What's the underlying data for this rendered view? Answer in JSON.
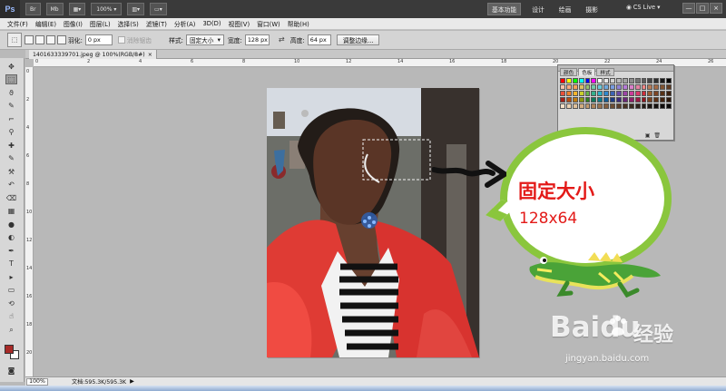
{
  "app": {
    "logo": "Ps",
    "zoom": "100%",
    "workspace_tabs": [
      "基本功能",
      "设计",
      "绘画",
      "摄影"
    ],
    "cslive": "CS Live",
    "window_controls": [
      "—",
      "□",
      "×"
    ]
  },
  "menu": [
    "文件(F)",
    "编辑(E)",
    "图像(I)",
    "图层(L)",
    "选择(S)",
    "滤镜(T)",
    "分析(A)",
    "3D(D)",
    "视图(V)",
    "窗口(W)",
    "帮助(H)"
  ],
  "options": {
    "feather_label": "羽化:",
    "feather_value": "0 px",
    "antialias_label": "消除锯齿",
    "style_label": "样式:",
    "style_value": "固定大小",
    "width_label": "宽度:",
    "width_value": "128 px",
    "height_label": "高度:",
    "height_value": "64 px",
    "refine_button": "调整边缘..."
  },
  "document": {
    "tab_title": "1401633339701.jpeg @ 100%(RGB/8#)",
    "close": "×",
    "status_zoom": "100%",
    "status_doc": "文档:595.3K/595.3K"
  },
  "rulers": {
    "top": [
      "0",
      "2",
      "4",
      "6",
      "8",
      "10",
      "12",
      "14",
      "16",
      "18",
      "20",
      "22",
      "24",
      "26"
    ],
    "left": [
      "0",
      "2",
      "4",
      "6",
      "8",
      "10",
      "12",
      "14",
      "16",
      "18",
      "20"
    ]
  },
  "swatches_panel": {
    "tabs": [
      "颜色",
      "色板",
      "样式"
    ],
    "colors": [
      "#ff0000",
      "#ffff00",
      "#00ff00",
      "#00ffff",
      "#0000ff",
      "#ff00ff",
      "#ffffff",
      "#e8e8e8",
      "#d1d1d1",
      "#b9b9b9",
      "#a2a2a2",
      "#8b8b8b",
      "#737373",
      "#5c5c5c",
      "#454545",
      "#2e2e2e",
      "#171717",
      "#000000",
      "#f6c1a9",
      "#f7a980",
      "#f5a05a",
      "#d8c163",
      "#94c16e",
      "#72c8a7",
      "#6bcad9",
      "#6fa7dd",
      "#779be0",
      "#8f82d6",
      "#b67bd7",
      "#da7fc9",
      "#e582a3",
      "#f08585",
      "#b57b58",
      "#a46a45",
      "#7f5230",
      "#5f3a20",
      "#e8503a",
      "#ee7f2d",
      "#f6b42c",
      "#c8cf2b",
      "#64b542",
      "#33b18c",
      "#2ab2c8",
      "#3087cc",
      "#3c63b4",
      "#694aa9",
      "#9b45a5",
      "#cc3c99",
      "#d9386c",
      "#cf2d3b",
      "#9b5a32",
      "#7c4322",
      "#573015",
      "#3c200d",
      "#a32019",
      "#b34c13",
      "#be7a10",
      "#8b9412",
      "#2f7e24",
      "#12775b",
      "#0f7888",
      "#145c94",
      "#1d3b83",
      "#3d2a7b",
      "#6b2677",
      "#8f1f69",
      "#991b43",
      "#8e1621",
      "#7a421f",
      "#5d3015",
      "#42220d",
      "#2c1608",
      "#f3e0c8",
      "#ead2b2",
      "#dfc19b",
      "#d2ad81",
      "#c29a6c",
      "#ac845c",
      "#98734f",
      "#835f40",
      "#6c4d34",
      "#5a3e2a",
      "#493223",
      "#3b2a1f",
      "#2e211a",
      "#231b15",
      "#1b1511",
      "#15110e",
      "#100d0b",
      "#0b0908"
    ]
  },
  "annotation": {
    "title": "固定大小",
    "size": "128x64"
  },
  "watermark": {
    "logo": "Bai",
    "logo_suffix": "du",
    "label": "经验",
    "url": "jingyan.baidu.com"
  }
}
